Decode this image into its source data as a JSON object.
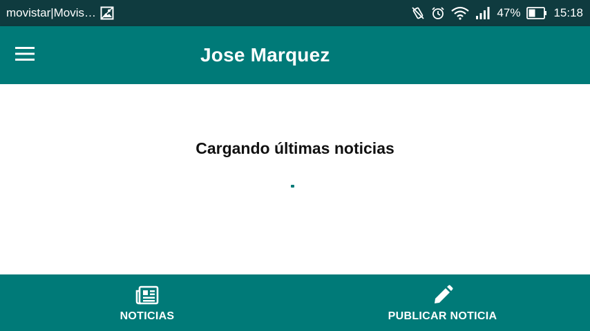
{
  "status_bar": {
    "carrier": "movistar|Movis…",
    "battery_percent": "47%",
    "time": "15:18",
    "icons": [
      "image-icon",
      "vibrate-icon",
      "alarm-icon",
      "wifi-icon",
      "signal-icon",
      "battery-icon"
    ]
  },
  "app_bar": {
    "title": "Jose Marquez",
    "menu_icon": "hamburger-menu-icon"
  },
  "main": {
    "loading_text": "Cargando últimas noticias"
  },
  "bottom_nav": {
    "items": [
      {
        "label": "NOTICIAS",
        "icon": "newspaper-icon"
      },
      {
        "label": "PUBLICAR NOTICIA",
        "icon": "pencil-icon"
      }
    ]
  },
  "colors": {
    "accent": "#007a78",
    "status_bar": "#0f3b3f",
    "background": "#ffffff",
    "text": "#111111"
  }
}
